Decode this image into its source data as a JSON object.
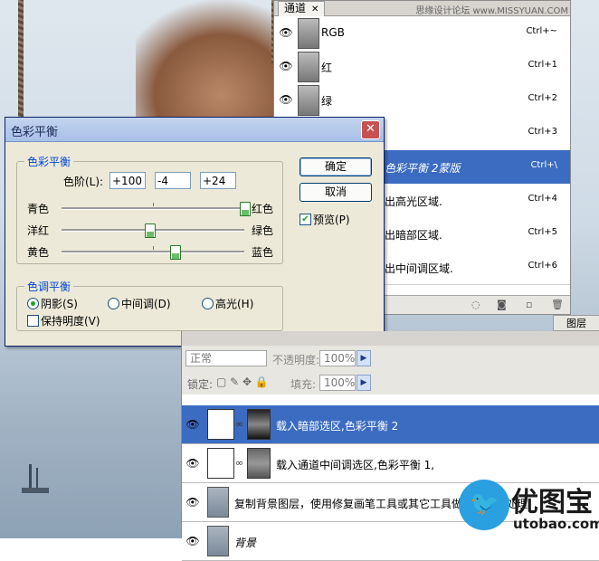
{
  "watermark": "思缘设计论坛 www.MISSYUAN.COM",
  "channels": {
    "tab_label": "通道",
    "rows": [
      {
        "name": "RGB",
        "shortcut": "Ctrl+~"
      },
      {
        "name": "红",
        "shortcut": "Ctrl+1"
      },
      {
        "name": "绿",
        "shortcut": "Ctrl+2"
      },
      {
        "name": "",
        "shortcut": "Ctrl+3"
      },
      {
        "name": "色彩平衡 2蒙版",
        "shortcut": "Ctrl+\\"
      },
      {
        "name": "出高光区域.",
        "shortcut": "Ctrl+4"
      },
      {
        "name": "出暗部区域.",
        "shortcut": "Ctrl+5"
      },
      {
        "name": "出中间调区域.",
        "shortcut": "Ctrl+6"
      }
    ],
    "selected_index": 4
  },
  "dialog": {
    "title": "色彩平衡",
    "group_balance": "色彩平衡",
    "levels_label": "色阶(L):",
    "levels": [
      "+100",
      "-4",
      "+24"
    ],
    "sliders": [
      {
        "left": "青色",
        "right": "红色",
        "value": 100
      },
      {
        "left": "洋红",
        "right": "绿色",
        "value": -4
      },
      {
        "left": "黄色",
        "right": "蓝色",
        "value": 24
      }
    ],
    "ok": "确定",
    "cancel": "取消",
    "preview": "预览(P)",
    "preview_checked": true,
    "group_tone": "色调平衡",
    "tones": [
      "阴影(S)",
      "中间调(D)",
      "高光(H)"
    ],
    "tone_selected": 0,
    "preserve": "保持明度(V)",
    "preserve_checked": false
  },
  "layers": {
    "tab_label": "图层",
    "blend_mode": "正常",
    "opacity_label": "不透明度:",
    "opacity": "100%",
    "lock_label": "锁定:",
    "fill_label": "填充:",
    "fill": "100%",
    "rows": [
      {
        "name": "载入暗部选区,色彩平衡 2",
        "type": "adjust",
        "selected": true
      },
      {
        "name": "载入通道中间调选区,色彩平衡 1,",
        "type": "adjust",
        "selected": false
      },
      {
        "name": "复制背景图层，使用修复画笔工具或其它工具做皮肤去污处理",
        "type": "photo",
        "selected": false
      },
      {
        "name": "背景",
        "type": "photo",
        "selected": false
      }
    ]
  },
  "logo": {
    "cn": "优图宝",
    "en": "utobao.com"
  },
  "colors": {
    "selection": "#3b6cc2",
    "dialog_bg": "#ece9d8",
    "legend": "#0046d5"
  }
}
